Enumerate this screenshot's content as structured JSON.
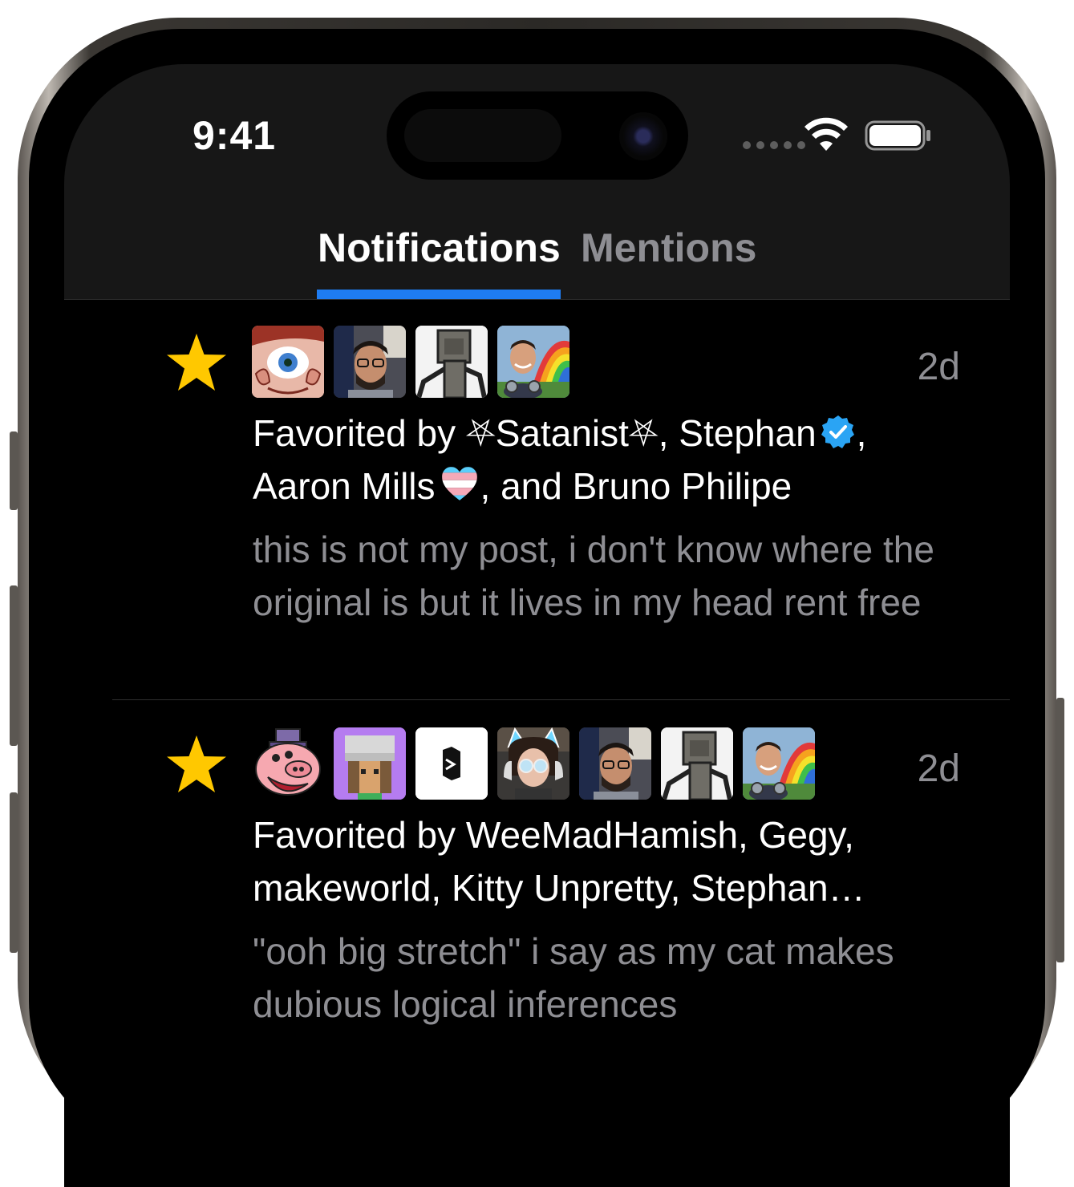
{
  "status_bar": {
    "time": "9:41"
  },
  "tabs": [
    {
      "label": "Notifications",
      "active": true
    },
    {
      "label": "Mentions",
      "active": false
    }
  ],
  "colors": {
    "accent": "#1e7cf2",
    "star": "#ffc800",
    "secondary_text": "#8e8e93",
    "background": "#000000",
    "header": "#171717"
  },
  "notifications": [
    {
      "type_icon": "star-icon",
      "time": "2d",
      "title_prefix": "Favorited by ",
      "names": [
        {
          "name": "⛧Satanist⛧",
          "badge": null,
          "sep": ", "
        },
        {
          "name": "Stephan",
          "badge": "verified-badge-icon",
          "sep": ","
        },
        {
          "name": "Aaron Mills",
          "badge": "trans-heart-icon",
          "sep": ", and "
        },
        {
          "name": "Bruno Philipe",
          "badge": null,
          "sep": ""
        }
      ],
      "body": "this is not my post, i don't know where the original is but it lives in my head rent free",
      "avatars": [
        "eye-hands-avatar",
        "glasses-man-avatar",
        "robot-avatar",
        "rainbow-man-avatar"
      ]
    },
    {
      "type_icon": "star-icon",
      "time": "2d",
      "title": "Favorited by WeeMadHamish, Gegy, makeworld, Kitty Unpretty, Stephan…",
      "body": "\"ooh big stretch\" i say as my cat makes dubious logical inferences",
      "avatars": [
        "pig-hat-avatar",
        "gegy-avatar",
        "makeworld-avatar",
        "kitty-avatar",
        "glasses-man-avatar",
        "robot-avatar",
        "rainbow-man-avatar"
      ]
    }
  ]
}
